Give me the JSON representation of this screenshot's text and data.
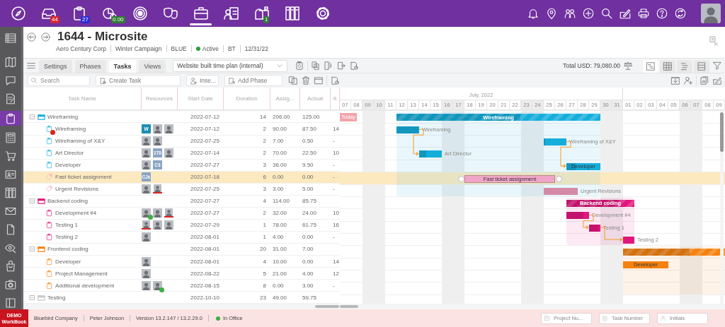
{
  "top_nav": [
    {
      "kind": "compass",
      "selected": false
    },
    {
      "kind": "inbox",
      "selected": false,
      "badge": "44",
      "color": "#d3262e"
    },
    {
      "kind": "clipboard",
      "selected": false,
      "badge": "27",
      "color": "#2b2bd6"
    },
    {
      "kind": "pie-chart",
      "selected": false,
      "badge": "0.00",
      "color": "#2e7d32"
    },
    {
      "kind": "target",
      "selected": false
    },
    {
      "kind": "masks",
      "selected": false
    },
    {
      "kind": "briefcase",
      "selected": true
    },
    {
      "kind": "team-clipboard",
      "selected": false
    },
    {
      "kind": "mailbox",
      "selected": false,
      "badge": "1",
      "color": "#2e7d32"
    },
    {
      "kind": "binders",
      "selected": false
    },
    {
      "kind": "gear",
      "selected": false
    }
  ],
  "top_actions": [
    {
      "kind": "bell"
    },
    {
      "kind": "map-pin"
    },
    {
      "kind": "people"
    },
    {
      "kind": "clock-plus"
    },
    {
      "kind": "search"
    },
    {
      "kind": "edit"
    },
    {
      "kind": "printer"
    },
    {
      "kind": "help"
    },
    {
      "kind": "refresh"
    },
    {
      "kind": "avatar"
    }
  ],
  "sidebar": [
    {
      "kind": "list",
      "selected": false
    },
    {
      "kind": "map",
      "selected": false
    },
    {
      "kind": "chat",
      "selected": false
    },
    {
      "kind": "note",
      "selected": false
    },
    {
      "kind": "clipboard",
      "selected": true
    },
    {
      "kind": "calculator",
      "selected": false
    },
    {
      "kind": "cart",
      "selected": false
    },
    {
      "kind": "id-card",
      "selected": false
    },
    {
      "kind": "binders",
      "selected": false
    },
    {
      "kind": "envelope",
      "selected": false
    },
    {
      "kind": "document",
      "selected": false
    },
    {
      "kind": "eye-search",
      "selected": false
    },
    {
      "kind": "bag",
      "selected": false
    },
    {
      "kind": "gear-box",
      "selected": false
    },
    {
      "kind": "panel",
      "selected": false
    }
  ],
  "header": {
    "title": "1644 - Microsite",
    "tool": {
      "kind": "assign"
    },
    "meta": [
      {
        "text": "Aero Century Corp"
      },
      {
        "text": "Winter Campaign"
      },
      {
        "text": "BLUE"
      },
      {
        "text": "Active",
        "color": "#2e9e3a"
      },
      {
        "text": "BT"
      },
      {
        "text": "12/31/22"
      }
    ]
  },
  "tabs": [
    {
      "label": "Settings",
      "selected": false
    },
    {
      "label": "Phases",
      "selected": false
    },
    {
      "label": "Tasks",
      "selected": true
    },
    {
      "label": "Views",
      "selected": false
    }
  ],
  "plan_select": {
    "value": "Website built time plan (internal)"
  },
  "tab_tools": [
    {
      "kind": "clipboard-refresh"
    },
    {
      "kind": "documents"
    },
    {
      "kind": "split"
    },
    {
      "kind": "export"
    },
    {
      "kind": "approve"
    }
  ],
  "total": "Total USD: 79,080.00",
  "views": [
    {
      "kind": "gantt",
      "selected": true
    },
    {
      "kind": "grid",
      "selected": false
    },
    {
      "kind": "tree",
      "selected": false
    },
    {
      "kind": "rows",
      "selected": false
    }
  ],
  "search": {
    "placeholder": "Search"
  },
  "actions": [
    {
      "kind": "create",
      "label": "Create Task"
    },
    {
      "kind": "insert",
      "label": "Inse..."
    },
    {
      "kind": "phase",
      "label": "Add Phase"
    }
  ],
  "toolbar_tools": [
    {
      "kind": "copy"
    },
    {
      "kind": "trash"
    },
    {
      "kind": "window"
    },
    {
      "kind": "approve"
    }
  ],
  "toolbar_right": [
    {
      "kind": "download"
    },
    {
      "kind": "user-add"
    },
    {
      "kind": "doc-chart"
    },
    {
      "kind": "edit"
    }
  ],
  "table": {
    "columns": [
      "Task Name",
      "Resources",
      "Start Date",
      "Duration",
      "Assig...",
      "Actual",
      "It"
    ],
    "rows": [
      {
        "kind": "phase",
        "name": "Wireframing",
        "color": "#14aedb",
        "expanded": true,
        "selected": false,
        "start": "2022-07-12",
        "duration": "14",
        "assigned": "206.00",
        "actual": "125.00",
        "bar": {
          "label": "Wireframing",
          "inside": true
        },
        "children": [
          {
            "kind": "task",
            "name": "Wireframing",
            "alert": true,
            "selected": false,
            "linked": true,
            "start": "2022-07-12",
            "duration": "2",
            "assigned": "90.00",
            "actual": "87.50",
            "column_7": "14",
            "bar": {
              "label": "Wireframing",
              "inside": false
            },
            "resources": [
              {
                "kind": "initials",
                "text": "W",
                "color": "#1d8fb3"
              },
              {
                "kind": "photo",
                "approved": false,
                "flagged": false
              },
              {
                "kind": "photo",
                "approved": false,
                "flagged": false
              }
            ]
          },
          {
            "kind": "task",
            "name": "Wireframing of X&Y",
            "alert": false,
            "selected": false,
            "linked": true,
            "start": "2022-07-25",
            "duration": "2",
            "assigned": "7.00",
            "actual": "0.50",
            "column_7": "-",
            "bar": {
              "label": "Wireframing of X&Y",
              "inside": false
            },
            "resources": [
              {
                "kind": "photo",
                "approved": false,
                "flagged": false
              },
              {
                "kind": "photo",
                "approved": false,
                "flagged": false
              }
            ]
          },
          {
            "kind": "task",
            "name": "Art Director",
            "alert": false,
            "selected": false,
            "linked": false,
            "start": "2022-07-14",
            "duration": "2",
            "assigned": "70.00",
            "actual": "22.50",
            "column_7": "10",
            "bar": {
              "label": "Art Director",
              "inside": false
            },
            "resources": [
              {
                "kind": "photo",
                "approved": false,
                "flagged": false
              },
              {
                "kind": "initials",
                "text": "270",
                "color": "#8aa5c2"
              },
              {
                "kind": "photo",
                "approved": false,
                "flagged": false
              }
            ]
          },
          {
            "kind": "task",
            "name": "Developer",
            "alert": false,
            "selected": false,
            "linked": false,
            "start": "2022-07-27",
            "duration": "3",
            "assigned": "36.00",
            "actual": "9.50",
            "column_7": "-",
            "bar": {
              "label": "Developer",
              "inside": true
            },
            "resources": [
              {
                "kind": "photo",
                "approved": false,
                "flagged": false
              },
              {
                "kind": "initials",
                "text": "C3",
                "color": "#8aa5c2"
              }
            ]
          },
          {
            "kind": "ticket",
            "name": "Fast ticket assignment",
            "selected": true,
            "linked": false,
            "start": "2022-07-18",
            "duration": "6",
            "assigned": "0.00",
            "actual": "0.00",
            "column_7": "-",
            "bar": {
              "label": "Fast ticket assignment",
              "inside": true
            },
            "resources": [
              {
                "kind": "initials",
                "text": "CJs",
                "color": "#8aa5c2"
              }
            ]
          },
          {
            "kind": "ticket",
            "name": "Urgent Revisions",
            "selected": false,
            "linked": false,
            "start": "2022-07-25",
            "duration": "3",
            "assigned": "3.00",
            "actual": "5.00",
            "column_7": "-",
            "bar": {
              "label": "Urgent Revisions",
              "inside": false
            },
            "resources": [
              {
                "kind": "photo",
                "approved": false,
                "flagged": false
              },
              {
                "kind": "photo",
                "approved": false,
                "flagged": true
              }
            ]
          }
        ]
      },
      {
        "kind": "phase",
        "name": "Backend coding",
        "color": "#e0167c",
        "expanded": true,
        "selected": false,
        "start": "2022-07-27",
        "duration": "4",
        "assigned": "114.00",
        "actual": "85.75",
        "bar": {
          "label": "Backend coding",
          "inside": true
        },
        "children": [
          {
            "kind": "task",
            "name": "Development #4",
            "alert": false,
            "selected": false,
            "linked": true,
            "start": "2022-07-27",
            "duration": "2",
            "assigned": "32.00",
            "actual": "24.00",
            "column_7": "10",
            "bar": {
              "label": "Development #4",
              "inside": false
            },
            "resources": [
              {
                "kind": "photo",
                "approved": true,
                "flagged": false
              },
              {
                "kind": "photo",
                "approved": false,
                "flagged": false
              },
              {
                "kind": "photo",
                "approved": false,
                "flagged": true
              }
            ]
          },
          {
            "kind": "task",
            "name": "Testing 1",
            "alert": false,
            "selected": false,
            "linked": true,
            "start": "2022-07-29",
            "duration": "1",
            "assigned": "78.00",
            "actual": "61.75",
            "column_7": "16",
            "bar": {
              "label": "Testing 1",
              "inside": false
            },
            "resources": [
              {
                "kind": "photo",
                "approved": false,
                "flagged": true
              },
              {
                "kind": "photo",
                "approved": false,
                "flagged": false
              },
              {
                "kind": "photo",
                "approved": false,
                "flagged": false
              }
            ]
          },
          {
            "kind": "task",
            "name": "Testing 2",
            "alert": false,
            "selected": false,
            "linked": false,
            "start": "2022-08-01",
            "duration": "1",
            "assigned": "4.00",
            "actual": "0.00",
            "column_7": "-",
            "bar": {
              "label": "Testing 2",
              "inside": false
            },
            "resources": [
              {
                "kind": "photo",
                "approved": false,
                "flagged": false
              }
            ]
          }
        ]
      },
      {
        "kind": "phase",
        "name": "Frontend coding",
        "color": "#f5820f",
        "expanded": true,
        "selected": false,
        "start": "2022-08-01",
        "duration": "20",
        "assigned": "31.00",
        "actual": "7.00",
        "bar": {
          "inside": true
        },
        "children": [
          {
            "kind": "task",
            "name": "Developer",
            "alert": false,
            "selected": false,
            "linked": false,
            "start": "2022-08-01",
            "duration": "4",
            "assigned": "10.00",
            "actual": "0.00",
            "column_7": "14",
            "bar": {
              "label": "Developer",
              "inside": true
            },
            "resources": [
              {
                "kind": "photo",
                "approved": false,
                "flagged": false
              }
            ]
          },
          {
            "kind": "task",
            "name": "Project Management",
            "alert": false,
            "selected": false,
            "linked": false,
            "start": "2022-08-22",
            "duration": "5",
            "assigned": "21.00",
            "actual": "4.00",
            "column_7": "12",
            "resources": [
              {
                "kind": "photo",
                "approved": false,
                "flagged": false
              }
            ]
          },
          {
            "kind": "task",
            "name": "Additional development",
            "alert": false,
            "selected": false,
            "linked": false,
            "start": "2022-08-15",
            "duration": "8",
            "assigned": "0.00",
            "actual": "3.00",
            "column_7": "-",
            "resources": [
              {
                "kind": "photo",
                "approved": false,
                "flagged": false
              },
              {
                "kind": "photo",
                "approved": true,
                "flagged": false
              }
            ]
          }
        ]
      },
      {
        "kind": "phase",
        "name": "Testing",
        "color": "#c8c8c8",
        "expanded": true,
        "selected": false,
        "start": "2022-10-10",
        "duration": "23",
        "assigned": "49.00",
        "actual": "59.75"
      }
    ]
  },
  "gantt": {
    "today": "Today",
    "months": [
      {
        "label": "July, 2022",
        "days": [
          {
            "label": "07",
            "weekend": false
          },
          {
            "label": "08",
            "weekend": false
          },
          {
            "label": "09",
            "weekend": true
          },
          {
            "label": "10",
            "weekend": true
          },
          {
            "label": "11",
            "weekend": false
          },
          {
            "label": "12",
            "weekend": false
          },
          {
            "label": "13",
            "weekend": false
          },
          {
            "label": "14",
            "weekend": false
          },
          {
            "label": "15",
            "weekend": false
          },
          {
            "label": "16",
            "weekend": true
          },
          {
            "label": "17",
            "weekend": true
          },
          {
            "label": "18",
            "weekend": false
          },
          {
            "label": "19",
            "weekend": false
          },
          {
            "label": "20",
            "weekend": false
          },
          {
            "label": "21",
            "weekend": false
          },
          {
            "label": "22",
            "weekend": false
          },
          {
            "label": "23",
            "weekend": true
          },
          {
            "label": "24",
            "weekend": true
          },
          {
            "label": "25",
            "weekend": false
          },
          {
            "label": "26",
            "weekend": false
          },
          {
            "label": "27",
            "weekend": false
          },
          {
            "label": "28",
            "weekend": false
          },
          {
            "label": "29",
            "weekend": false
          },
          {
            "label": "30",
            "weekend": true
          },
          {
            "label": "31",
            "weekend": true
          }
        ]
      },
      {
        "days": [
          {
            "label": "01",
            "weekend": false
          },
          {
            "label": "02",
            "weekend": false
          },
          {
            "label": "03",
            "weekend": false
          },
          {
            "label": "04",
            "weekend": false
          },
          {
            "label": "05",
            "weekend": false
          },
          {
            "label": "06",
            "weekend": true
          },
          {
            "label": "07",
            "weekend": true
          },
          {
            "label": "08",
            "weekend": false
          },
          {
            "label": "09",
            "weekend": false
          }
        ]
      }
    ]
  },
  "status_bar": {
    "badge": {
      "title": "DEMO",
      "subtitle": "WorkBook"
    },
    "items": [
      "Bluebird Company",
      "Peter Johnson",
      "Version 13.2.147 / 13.2.29.0"
    ],
    "presence": {
      "text": "In Office",
      "color": "#3cb043"
    },
    "fields": [
      {
        "kind": "project",
        "placeholder": "Project Nu..."
      },
      {
        "kind": "task",
        "placeholder": "Task Number"
      },
      {
        "kind": "person",
        "placeholder": "Initials"
      }
    ]
  }
}
